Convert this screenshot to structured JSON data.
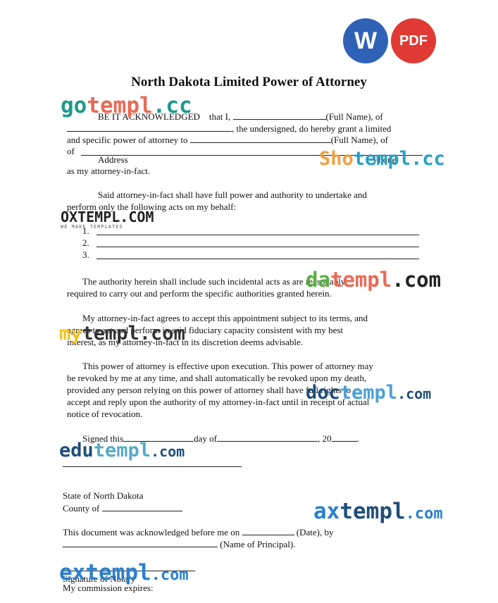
{
  "badges": {
    "word": "W",
    "pdf": "PDF"
  },
  "document": {
    "title": "North Dakota Limited Power of Attorney",
    "p1_a": "BE IT ACKNOWLEDGED",
    "p1_b": "that I,",
    "p1_c": "(Full Name), of",
    "p1_d": ", the undersigned, do hereby grant a limited",
    "p1_e": "and specific power of attorney to",
    "p1_f": "(Full Name), of",
    "p1_g": "of",
    "p1_address": "Address",
    "p1_phone": "Phone",
    "p1_h": "as my attorney-in-fact.",
    "p2_1": "Said attorney-in-fact shall have full power and authority to undertake and",
    "p2_2": "perform only the following acts on my behalf:",
    "list": [
      "1.",
      "2.",
      "3."
    ],
    "p3_1": "The authority herein shall include such incidental acts as are reasonably",
    "p3_2": "required to carry out and perform the specific authorities granted herein.",
    "p4_1": "My attorney-in-fact agrees to accept this appointment subject to its terms, and",
    "p4_2": "agrees to act and perform in said fiduciary capacity consistent with my best",
    "p4_3": "interest, as my attorney-in-fact in its discretion deems advisable.",
    "p5_1": "This power of attorney is effective upon execution. This power of attorney may",
    "p5_2": "be revoked by me at any time, and shall automatically be revoked upon my death,",
    "p5_3": "provided any person relying on this power of attorney shall have full rights to",
    "p5_4": "accept and reply upon the authority of my attorney-in-fact until in receipt of actual",
    "p5_5": "notice of revocation.",
    "signed_a": "Signed this",
    "signed_b": "day of",
    "signed_c": ", 20",
    "signed_d": ".",
    "state": "State of North Dakota",
    "county": "County of",
    "ack_1": "This document was acknowledged before me on",
    "ack_2": "(Date), by",
    "ack_3": "(Name of Principal).",
    "sig_notary": "Signature of Notary",
    "commission": "My commission expires:"
  },
  "watermarks": {
    "gotempl": [
      "go",
      "templ",
      ".cc"
    ],
    "oxtempl": [
      "OXTEMPL.COM",
      "WE MAKE TEMPLATES"
    ],
    "shotempl": [
      "Sho",
      "templ",
      ".cc"
    ],
    "datempl": [
      "da",
      "templ",
      ".com"
    ],
    "mytempl": [
      "my",
      "templ",
      ".com"
    ],
    "doctempl": [
      "doc",
      "templ",
      ".com"
    ],
    "edutempl": [
      "edu",
      "templ",
      ".com"
    ],
    "axtempl": [
      "ax",
      "templ",
      ".com"
    ],
    "extempl": [
      "ex",
      "templ",
      ".com"
    ]
  },
  "colors": {
    "word": "#2f62b7",
    "pdf": "#e03a34",
    "teal": "#1e9a8c",
    "salmon": "#e96a54",
    "orange": "#f0a040",
    "cyan": "#27a0c8",
    "green": "#58b040",
    "yellow": "#f2c21c",
    "navy": "#1f4e79",
    "lightblue": "#4aa0d8",
    "blue": "#2a80d0"
  }
}
